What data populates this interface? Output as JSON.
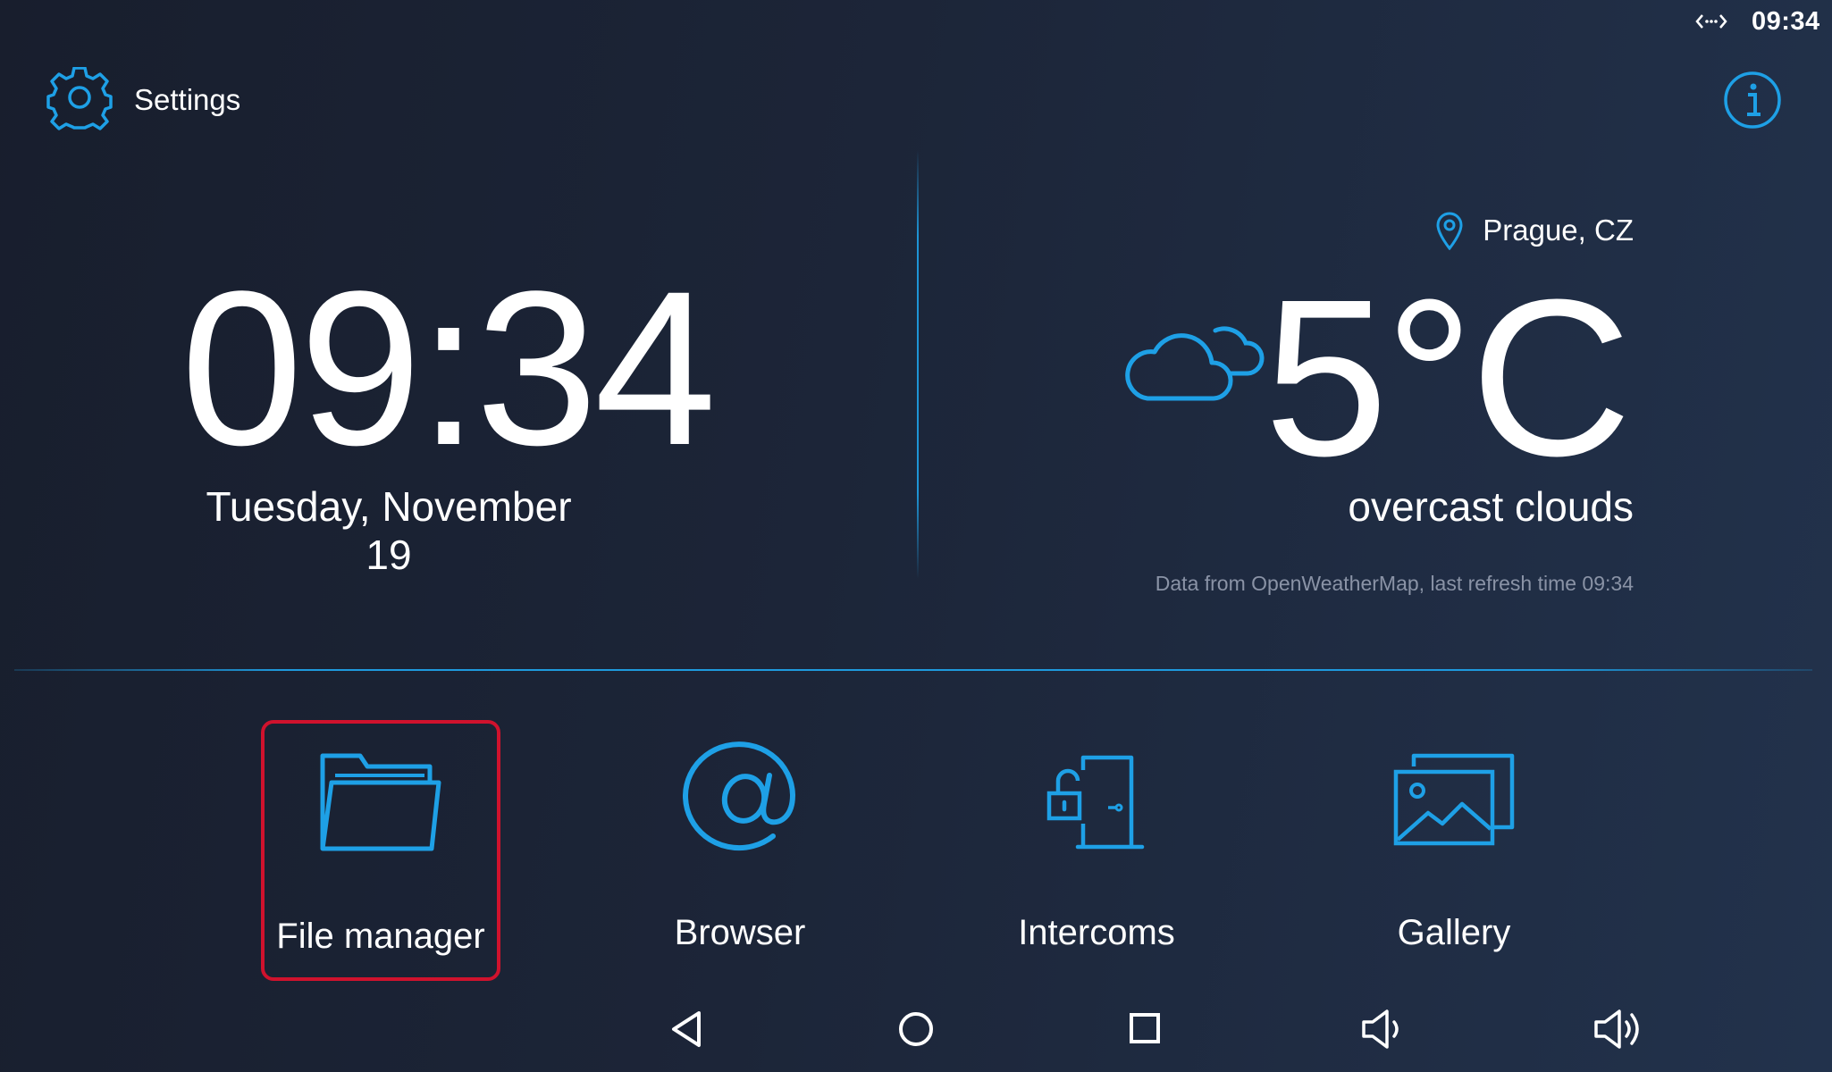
{
  "status_bar": {
    "time": "09:34",
    "network_icon": "ethernet-icon"
  },
  "header": {
    "settings_label": "Settings",
    "settings_icon": "gear-icon",
    "info_icon": "info-icon"
  },
  "clock": {
    "time": "09:34",
    "date": "Tuesday, November 19"
  },
  "weather": {
    "location": "Prague, CZ",
    "temperature": "5°C",
    "description": "overcast clouds",
    "source": "Data from OpenWeatherMap, last refresh time 09:34",
    "icon": "cloud-icon"
  },
  "apps": [
    {
      "label": "File manager",
      "icon": "folder-icon",
      "selected": true
    },
    {
      "label": "Browser",
      "icon": "at-icon",
      "selected": false
    },
    {
      "label": "Intercoms",
      "icon": "door-lock-icon",
      "selected": false
    },
    {
      "label": "Gallery",
      "icon": "gallery-icon",
      "selected": false
    }
  ],
  "nav": [
    "back-icon",
    "home-icon",
    "recent-apps-icon",
    "volume-down-icon",
    "volume-up-icon"
  ],
  "colors": {
    "accent": "#1ea0e6",
    "selection": "#d0122d",
    "background": "#1c2538",
    "muted_text": "#8a93a6"
  }
}
